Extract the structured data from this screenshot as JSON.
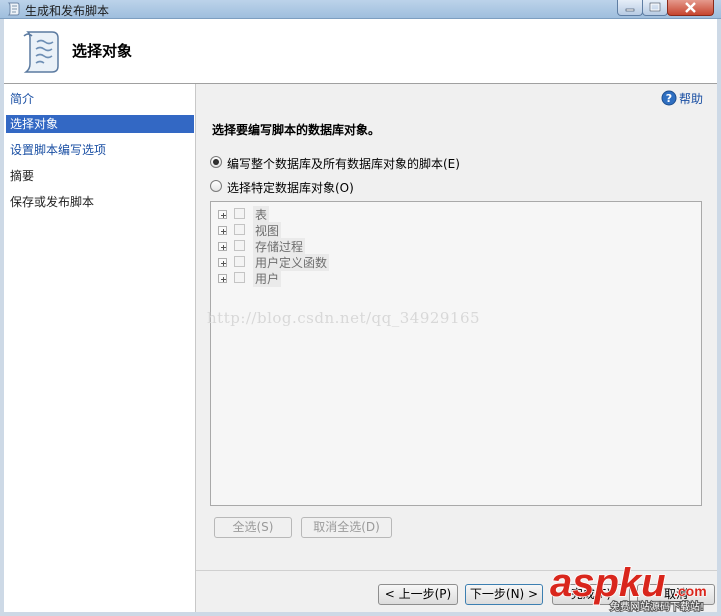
{
  "window": {
    "title": "生成和发布脚本"
  },
  "header": {
    "title": "选择对象",
    "icon": "script-scroll-icon"
  },
  "nav": {
    "items": [
      {
        "label": "简介",
        "state": "link"
      },
      {
        "label": "选择对象",
        "state": "selected"
      },
      {
        "label": "设置脚本编写选项",
        "state": "link"
      },
      {
        "label": "摘要",
        "state": "plain"
      },
      {
        "label": "保存或发布脚本",
        "state": "plain"
      }
    ]
  },
  "help": {
    "label": "帮助",
    "icon": "help-icon"
  },
  "content": {
    "section_title": "选择要编写脚本的数据库对象。",
    "options": [
      {
        "label": "编写整个数据库及所有数据库对象的脚本(E)",
        "selected": true
      },
      {
        "label": "选择特定数据库对象(O)",
        "selected": false
      }
    ],
    "tree": {
      "items": [
        {
          "label": "表"
        },
        {
          "label": "视图"
        },
        {
          "label": "存储过程"
        },
        {
          "label": "用户定义函数"
        },
        {
          "label": "用户"
        }
      ]
    },
    "watermark": "http://blog.csdn.net/qq_34929165",
    "select_all": "全选(S)",
    "deselect_all": "取消全选(D)"
  },
  "footer": {
    "prev": "< 上一步(P)",
    "next": "下一步(N) >",
    "finish": "完成(F)",
    "cancel": "取消"
  },
  "overlay_logo": {
    "text": "aspku",
    "suffix": ".com",
    "tagline": "免费网站源码下载站!"
  },
  "colors": {
    "selected_nav": "#3368c4",
    "link": "#1a4fa3",
    "logo_red": "#d9261c"
  }
}
